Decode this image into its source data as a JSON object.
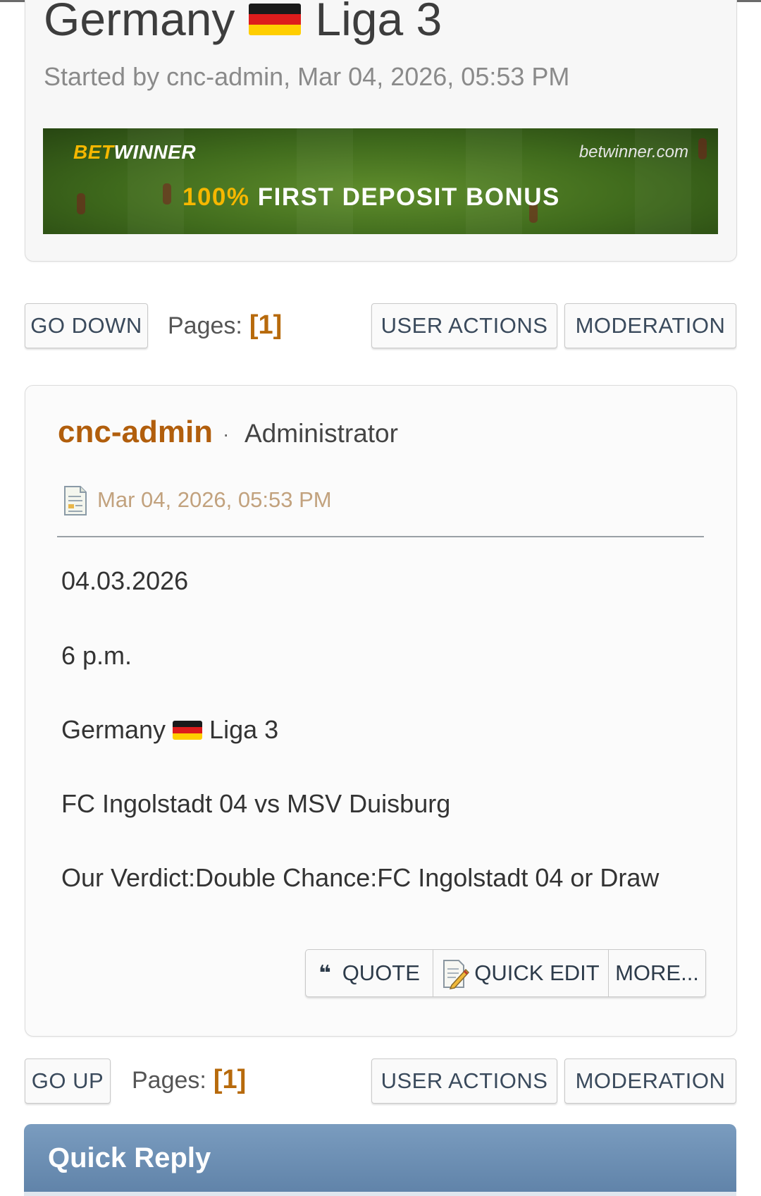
{
  "topic": {
    "title_before_flag": "Germany",
    "title_after_flag": "Liga 3",
    "started_by": "Started by cnc-admin, Mar 04, 2026, 05:53 PM"
  },
  "banner": {
    "brand_part1": "BET",
    "brand_part2": "WINNER",
    "site": "betwinner.com",
    "bonus_pct": "100%",
    "bonus_text": "FIRST DEPOSIT BONUS"
  },
  "nav_top": {
    "go_down": "GO DOWN",
    "pages_label": "Pages:",
    "page_num": "[1]",
    "user_actions": "USER ACTIONS",
    "moderation": "MODERATION"
  },
  "post": {
    "author": "cnc-admin",
    "separator": "·",
    "role": "Administrator",
    "date": "Mar 04, 2026, 05:53 PM",
    "line_date": "04.03.2026",
    "line_time": "6 p.m.",
    "league_before_flag": "Germany",
    "league_after_flag": "Liga 3",
    "match": "FC Ingolstadt 04 vs MSV Duisburg",
    "verdict": "Our Verdict:Double Chance:FC Ingolstadt 04 or Draw",
    "actions": {
      "quote": "QUOTE",
      "quick_edit": "QUICK EDIT",
      "more": "MORE..."
    }
  },
  "nav_bottom": {
    "go_up": "GO UP",
    "pages_label": "Pages:",
    "page_num": "[1]",
    "user_actions": "USER ACTIONS",
    "moderation": "MODERATION"
  },
  "quick_reply": {
    "title": "Quick Reply"
  },
  "icons": {
    "flag": "germany-flag-icon",
    "post": "document-icon",
    "quote": "quote-icon",
    "edit": "edit-icon"
  },
  "colors": {
    "author": "#b15e0c",
    "page_num": "#b76a0c",
    "quick_reply_bar": "#6b8db3"
  }
}
